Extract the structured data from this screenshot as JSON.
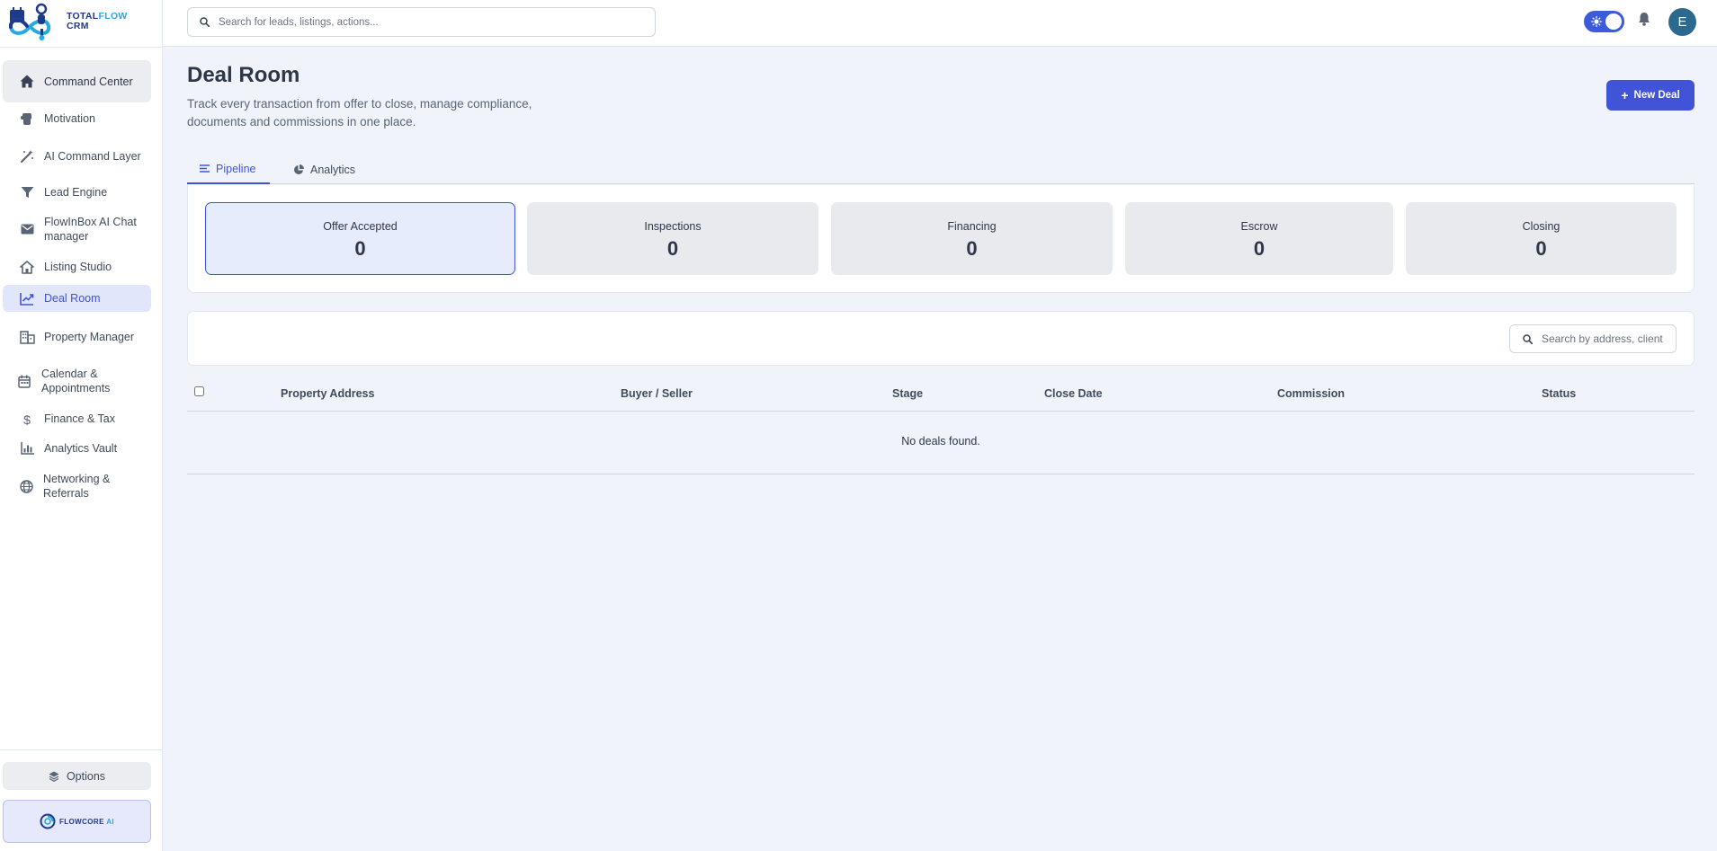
{
  "brand": {
    "logo_line1": "TOTAL",
    "logo_line1_accent": "FLOW",
    "logo_line2": "CRM",
    "partner_name": "FLOWCORE",
    "partner_accent": "AI"
  },
  "search": {
    "placeholder": "Search for leads, listings, actions..."
  },
  "header": {
    "avatar_initial": "E",
    "theme_toggle": "light"
  },
  "sidebar": {
    "items": [
      {
        "label": "Command Center",
        "icon": "home-icon"
      },
      {
        "label": "Motivation",
        "icon": "fist-icon"
      },
      {
        "label": "AI Command Layer",
        "icon": "magic-wand-icon"
      },
      {
        "label": "Lead Engine",
        "icon": "funnel-icon"
      },
      {
        "label": "FlowInBox AI Chat manager",
        "icon": "mail-icon"
      },
      {
        "label": "Listing Studio",
        "icon": "house-icon"
      },
      {
        "label": "Deal Room",
        "icon": "deal-chart-icon"
      },
      {
        "label": "Property Manager",
        "icon": "buildings-icon"
      },
      {
        "label": "Calendar & Appointments",
        "icon": "calendar-icon"
      },
      {
        "label": "Finance & Tax",
        "icon": "dollar-icon"
      },
      {
        "label": "Analytics Vault",
        "icon": "bar-chart-icon"
      },
      {
        "label": "Networking & Referrals",
        "icon": "globe-icon"
      }
    ],
    "active_item": "Deal Room",
    "options_label": "Options"
  },
  "page": {
    "title": "Deal Room",
    "subtitle": "Track every transaction from offer to close, manage compliance, documents and commissions in one place.",
    "new_deal_label": "New Deal"
  },
  "tabs": [
    {
      "label": "Pipeline",
      "icon": "list-icon",
      "active": true
    },
    {
      "label": "Analytics",
      "icon": "pie-chart-icon",
      "active": false
    }
  ],
  "stages": [
    {
      "label": "Offer Accepted",
      "count": "0",
      "selected": true
    },
    {
      "label": "Inspections",
      "count": "0",
      "selected": false
    },
    {
      "label": "Financing",
      "count": "0",
      "selected": false
    },
    {
      "label": "Escrow",
      "count": "0",
      "selected": false
    },
    {
      "label": "Closing",
      "count": "0",
      "selected": false
    }
  ],
  "table": {
    "search_placeholder": "Search by address, client",
    "columns": [
      "Property Address",
      "Buyer / Seller",
      "Stage",
      "Close Date",
      "Commission",
      "Status"
    ],
    "empty_message": "No deals found."
  },
  "colors": {
    "accent": "#4154d8",
    "sidebar_active_bg": "#e1e6fb",
    "page_bg": "#f0f4fa",
    "stage_bg": "#e8eaed",
    "avatar_bg": "#2b6a8e"
  }
}
